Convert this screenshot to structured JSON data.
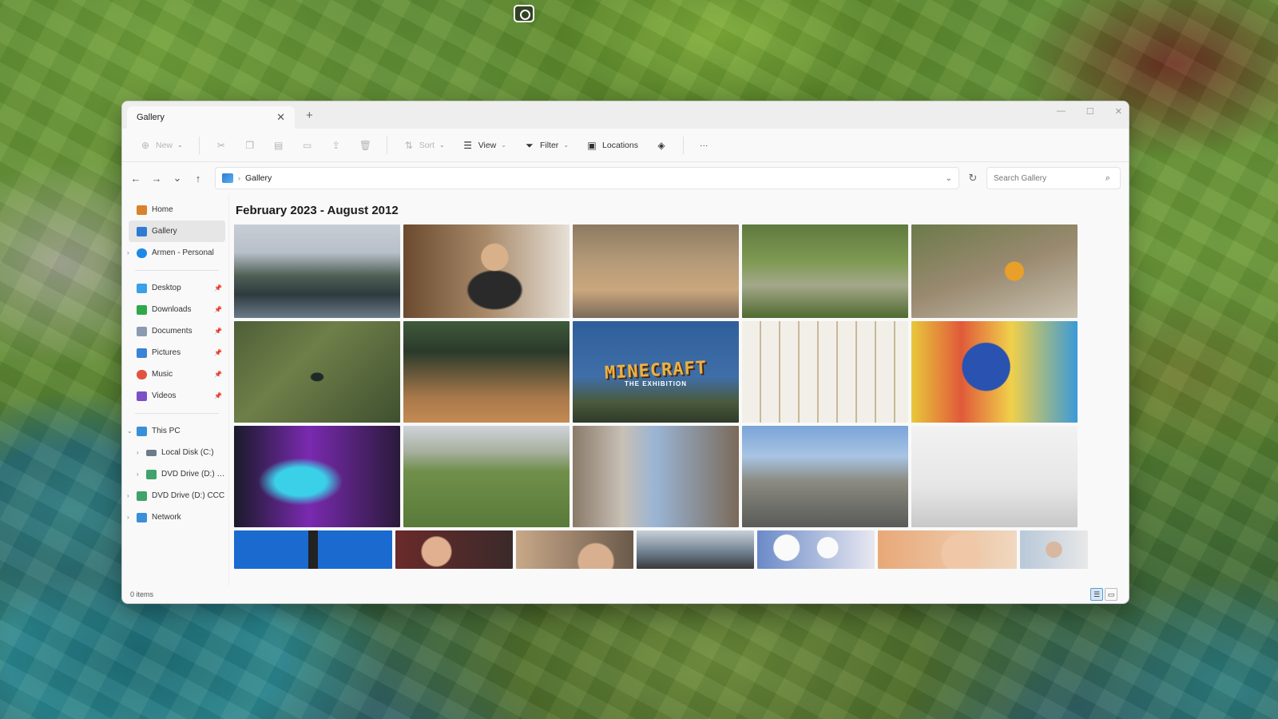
{
  "window": {
    "tab_title": "Gallery",
    "tab_close": "✕",
    "tab_add": "+"
  },
  "toolbar": {
    "new_label": "New",
    "sort_label": "Sort",
    "view_label": "View",
    "filter_label": "Filter",
    "locations_label": "Locations",
    "more_label": "···"
  },
  "address": {
    "path": "Gallery",
    "search_placeholder": "Search Gallery"
  },
  "sidebar": {
    "items": [
      {
        "label": "Home"
      },
      {
        "label": "Gallery"
      },
      {
        "label": "Armen - Personal"
      },
      {
        "label": "Desktop"
      },
      {
        "label": "Downloads"
      },
      {
        "label": "Documents"
      },
      {
        "label": "Pictures"
      },
      {
        "label": "Music"
      },
      {
        "label": "Videos"
      },
      {
        "label": "This PC"
      },
      {
        "label": "Local Disk (C:)"
      },
      {
        "label": "DVD Drive (D:) CC"
      },
      {
        "label": "DVD Drive (D:) CCC"
      },
      {
        "label": "Network"
      }
    ]
  },
  "gallery": {
    "heading": "February 2023 - August 2012",
    "minecraft_title": "MINECRAFT",
    "minecraft_sub": "THE EXHIBITION"
  },
  "status": {
    "items": "0 items"
  },
  "colors": {
    "accent": "#0067c0",
    "selected": "#e6e6e6"
  }
}
